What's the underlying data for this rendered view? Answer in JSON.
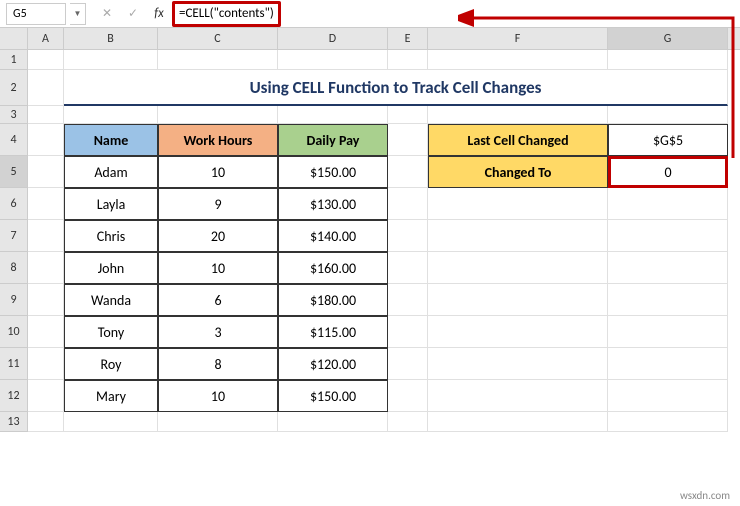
{
  "nameBox": "G5",
  "formula": "=CELL(\"contents\")",
  "title": "Using CELL Function to Track Cell Changes",
  "columns": [
    "A",
    "B",
    "C",
    "D",
    "E",
    "F",
    "G"
  ],
  "rowNums": [
    "1",
    "2",
    "3",
    "4",
    "5",
    "6",
    "7",
    "8",
    "9",
    "10",
    "11",
    "12",
    "13"
  ],
  "headers": {
    "name": "Name",
    "hours": "Work Hours",
    "pay": "Daily Pay"
  },
  "track": {
    "lastLabel": "Last Cell Changed",
    "lastValue": "$G$5",
    "changedLabel": "Changed To",
    "changedValue": "0"
  },
  "rows": [
    {
      "name": "Adam",
      "hours": "10",
      "pay": "$150.00"
    },
    {
      "name": "Layla",
      "hours": "9",
      "pay": "$130.00"
    },
    {
      "name": "Chris",
      "hours": "20",
      "pay": "$140.00"
    },
    {
      "name": "John",
      "hours": "10",
      "pay": "$160.00"
    },
    {
      "name": "Wanda",
      "hours": "6",
      "pay": "$180.00"
    },
    {
      "name": "Tony",
      "hours": "3",
      "pay": "$115.00"
    },
    {
      "name": "Roy",
      "hours": "8",
      "pay": "$120.00"
    },
    {
      "name": "Mary",
      "hours": "10",
      "pay": "$150.00"
    }
  ],
  "watermark": "wsxdn.com"
}
